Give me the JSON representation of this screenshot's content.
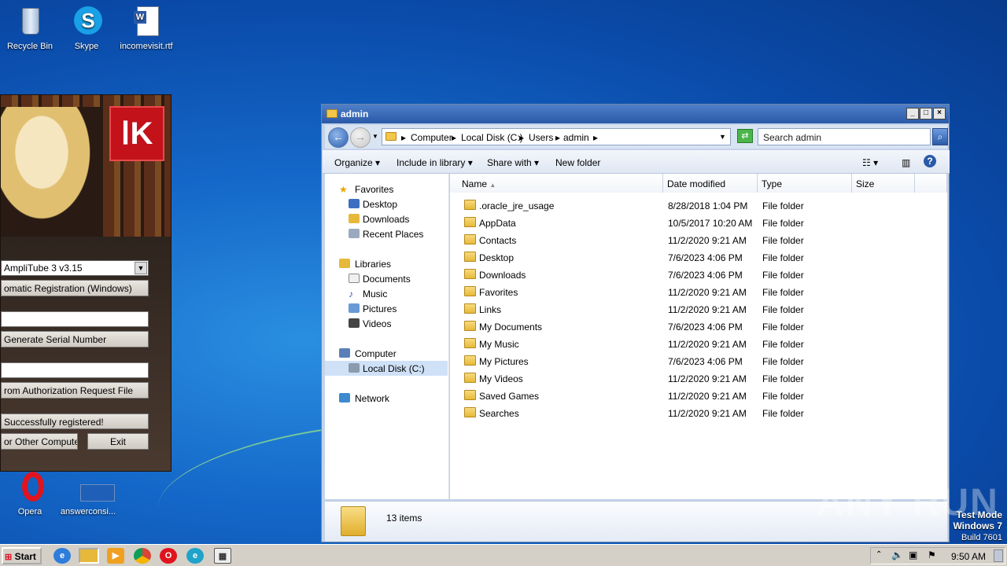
{
  "desktop": {
    "icons": [
      {
        "label": "Recycle Bin"
      },
      {
        "label": "Skype"
      },
      {
        "label": "incomevisit.rtf"
      },
      {
        "label": "Opera"
      },
      {
        "label": "answerconsi..."
      }
    ]
  },
  "keygen": {
    "product_select": "AmpliTube 3 v3.15",
    "registration_mode": "omatic Registration (Windows)",
    "generate_button": "Generate Serial Number",
    "auth_request_button": "rom Authorization Request File",
    "status": "Successfully registered!",
    "other_computers_button": "or Other Computers",
    "exit_button": "Exit"
  },
  "explorer": {
    "title": "admin",
    "breadcrumbs": [
      "Computer",
      "Local Disk (C:)",
      "Users",
      "admin"
    ],
    "search_placeholder": "Search admin",
    "toolbar": {
      "organize": "Organize",
      "include": "Include in library",
      "share": "Share with",
      "new_folder": "New folder"
    },
    "nav": {
      "favorites": "Favorites",
      "desktop": "Desktop",
      "downloads": "Downloads",
      "recent": "Recent Places",
      "libraries": "Libraries",
      "documents": "Documents",
      "music": "Music",
      "pictures": "Pictures",
      "videos": "Videos",
      "computer": "Computer",
      "local_disk": "Local Disk (C:)",
      "network": "Network"
    },
    "columns": {
      "name": "Name",
      "date": "Date modified",
      "type": "Type",
      "size": "Size"
    },
    "rows": [
      {
        "name": ".oracle_jre_usage",
        "date": "8/28/2018 1:04 PM",
        "type": "File folder"
      },
      {
        "name": "AppData",
        "date": "10/5/2017 10:20 AM",
        "type": "File folder"
      },
      {
        "name": "Contacts",
        "date": "11/2/2020 9:21 AM",
        "type": "File folder"
      },
      {
        "name": "Desktop",
        "date": "7/6/2023 4:06 PM",
        "type": "File folder"
      },
      {
        "name": "Downloads",
        "date": "7/6/2023 4:06 PM",
        "type": "File folder"
      },
      {
        "name": "Favorites",
        "date": "11/2/2020 9:21 AM",
        "type": "File folder"
      },
      {
        "name": "Links",
        "date": "11/2/2020 9:21 AM",
        "type": "File folder"
      },
      {
        "name": "My Documents",
        "date": "7/6/2023 4:06 PM",
        "type": "File folder"
      },
      {
        "name": "My Music",
        "date": "11/2/2020 9:21 AM",
        "type": "File folder"
      },
      {
        "name": "My Pictures",
        "date": "7/6/2023 4:06 PM",
        "type": "File folder"
      },
      {
        "name": "My Videos",
        "date": "11/2/2020 9:21 AM",
        "type": "File folder"
      },
      {
        "name": "Saved Games",
        "date": "11/2/2020 9:21 AM",
        "type": "File folder"
      },
      {
        "name": "Searches",
        "date": "11/2/2020 9:21 AM",
        "type": "File folder"
      }
    ],
    "item_count": "13 items"
  },
  "taskbar": {
    "start": "Start",
    "clock": "9:50 AM"
  },
  "watermark": {
    "line1": "Test Mode",
    "line2": "Windows 7",
    "line3": "Build 7601",
    "brand": "ANY RUN"
  },
  "colors": {
    "desktop_blue": "#1467c8",
    "title_blue": "#2a5aa8",
    "selection": "#cfe1f7"
  }
}
